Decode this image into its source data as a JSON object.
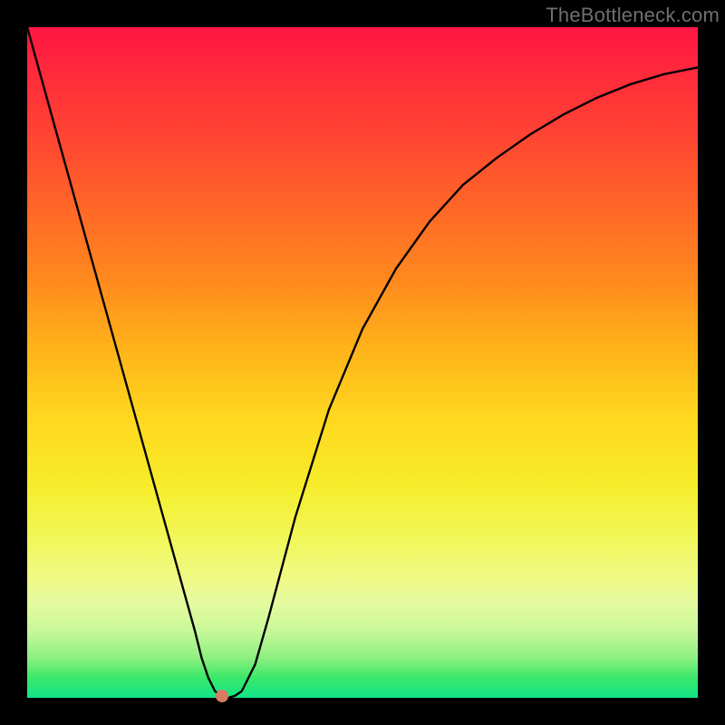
{
  "watermark": "TheBottleneck.com",
  "chart_data": {
    "type": "line",
    "title": "",
    "xlabel": "",
    "ylabel": "",
    "xlim": [
      0,
      100
    ],
    "ylim": [
      0,
      100
    ],
    "series": [
      {
        "name": "bottleneck-curve",
        "x": [
          0,
          5,
          10,
          15,
          20,
          25,
          26,
          27,
          28,
          29,
          30,
          31,
          32,
          34,
          36,
          40,
          45,
          50,
          55,
          60,
          65,
          70,
          75,
          80,
          85,
          90,
          95,
          100
        ],
        "y": [
          100,
          82,
          64,
          46,
          28,
          10,
          6,
          3,
          1,
          0.3,
          0,
          0.3,
          1,
          5,
          12,
          27,
          43,
          55,
          64,
          71,
          76.5,
          80.5,
          84,
          87,
          89.5,
          91.5,
          93,
          94
        ]
      }
    ],
    "marker": {
      "x": 29,
      "y": 0.3,
      "name": "current-point"
    },
    "gradient_stops": [
      {
        "pos": 0,
        "color": "#ff1644"
      },
      {
        "pos": 50,
        "color": "#ffd61e"
      },
      {
        "pos": 80,
        "color": "#f0fa84"
      },
      {
        "pos": 100,
        "color": "#12e588"
      }
    ]
  }
}
